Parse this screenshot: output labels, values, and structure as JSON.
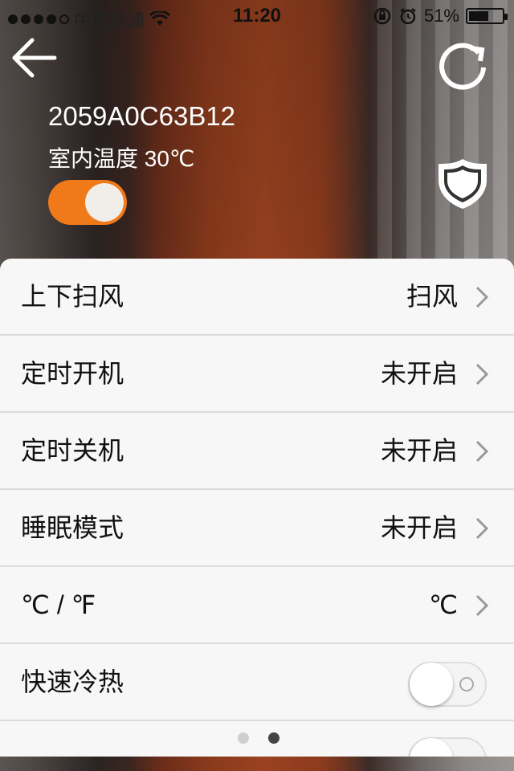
{
  "status_bar": {
    "carrier": "中国联通",
    "time": "11:20",
    "battery": "51%",
    "battery_level": 0.51
  },
  "header": {
    "device_id": "2059A0C63B12",
    "indoor_temp": "室内温度 30℃",
    "power_on": true
  },
  "icons": {
    "back": "back-arrow-icon",
    "refresh": "refresh-icon",
    "shield": "shield-icon",
    "chevron": "chevron-right-icon"
  },
  "colors": {
    "accent": "#f07a1a",
    "card_bg": "#f7f7f7"
  },
  "settings": [
    {
      "label": "上下扫风",
      "value": "扫风"
    },
    {
      "label": "定时开机",
      "value": "未开启"
    },
    {
      "label": "定时关机",
      "value": "未开启"
    },
    {
      "label": "睡眠模式",
      "value": "未开启"
    },
    {
      "label": "℃ / ℉",
      "value": "℃"
    },
    {
      "label": "快速冷热",
      "toggle": false
    }
  ],
  "pager": {
    "pages": 2,
    "active": 2
  }
}
